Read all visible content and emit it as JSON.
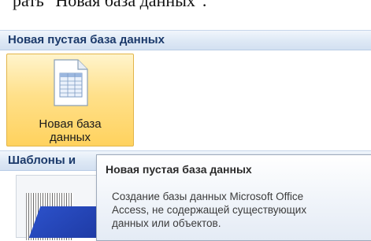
{
  "document": {
    "text": "рать \"Новая база данных\"."
  },
  "new_section": {
    "header": "Новая пустая база данных",
    "tile": {
      "icon": "database-document-icon",
      "label_line1": "Новая база",
      "label_line2": "данных"
    }
  },
  "templates_section": {
    "header": "Шаблоны и"
  },
  "tooltip": {
    "title": "Новая пустая база данных",
    "body_line1": "Создание базы данных Microsoft Office",
    "body_line2": "Access, не содержащей существующих",
    "body_line3": "данных или объектов."
  },
  "colors": {
    "header_text": "#1c3a6b",
    "tile_highlight": "#ffd25e",
    "tile_border": "#e2b54a",
    "tooltip_border": "#9eaabb"
  }
}
